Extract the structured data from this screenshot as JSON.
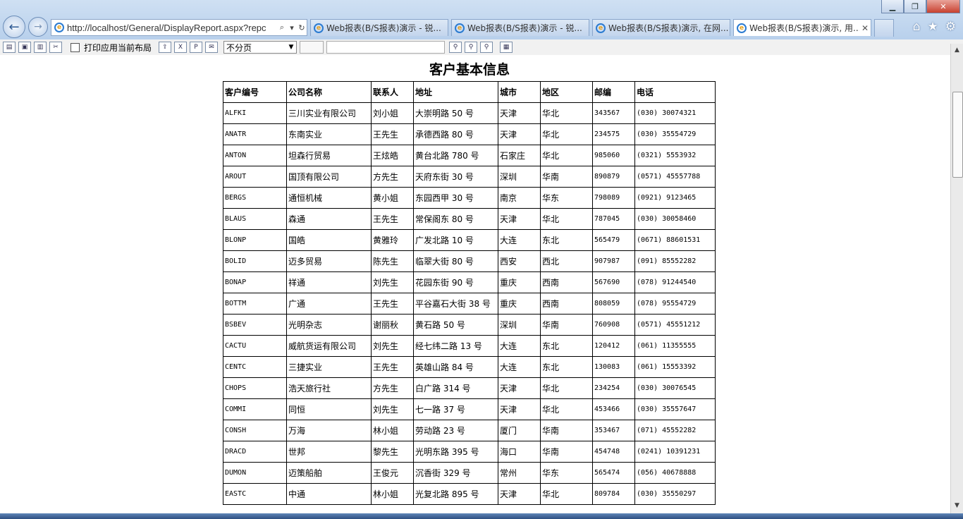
{
  "browser": {
    "address": "http://localhost/General/DisplayReport.aspx?repc",
    "tabs": [
      {
        "title": "Web报表(B/S报表)演示 - 锐...",
        "active": false
      },
      {
        "title": "Web报表(B/S报表)演示 - 锐...",
        "active": false
      },
      {
        "title": "Web报表(B/S报表)演示, 在网...",
        "active": false
      },
      {
        "title": "Web报表(B/S报表)演示, 用...",
        "active": true
      }
    ]
  },
  "toolbar": {
    "print_layout_label": "打印应用当前布局",
    "paging_option": "不分页"
  },
  "report": {
    "title": "客户基本信息",
    "columns": [
      "客户编号",
      "公司名称",
      "联系人",
      "地址",
      "城市",
      "地区",
      "邮编",
      "电话"
    ],
    "rows": [
      [
        "ALFKI",
        "三川实业有限公司",
        "刘小姐",
        "大崇明路 50 号",
        "天津",
        "华北",
        "343567",
        "(030) 30074321"
      ],
      [
        "ANATR",
        "东南实业",
        "王先生",
        "承德西路 80 号",
        "天津",
        "华北",
        "234575",
        "(030) 35554729"
      ],
      [
        "ANTON",
        "坦森行贸易",
        "王炫皓",
        "黄台北路 780 号",
        "石家庄",
        "华北",
        "985060",
        "(0321) 5553932"
      ],
      [
        "AROUT",
        "国顶有限公司",
        "方先生",
        "天府东街 30 号",
        "深圳",
        "华南",
        "890879",
        "(0571) 45557788"
      ],
      [
        "BERGS",
        "通恒机械",
        "黄小姐",
        "东园西甲 30 号",
        "南京",
        "华东",
        "798089",
        "(0921) 9123465"
      ],
      [
        "BLAUS",
        "森通",
        "王先生",
        "常保阁东 80 号",
        "天津",
        "华北",
        "787045",
        "(030) 30058460"
      ],
      [
        "BLONP",
        "国皓",
        "黄雅玲",
        "广发北路 10 号",
        "大连",
        "东北",
        "565479",
        "(0671) 88601531"
      ],
      [
        "BOLID",
        "迈多贸易",
        "陈先生",
        "临翠大街 80 号",
        "西安",
        "西北",
        "907987",
        "(091) 85552282"
      ],
      [
        "BONAP",
        "祥通",
        "刘先生",
        "花园东街 90 号",
        "重庆",
        "西南",
        "567690",
        "(078) 91244540"
      ],
      [
        "BOTTM",
        "广通",
        "王先生",
        "平谷嘉石大街 38 号",
        "重庆",
        "西南",
        "808059",
        "(078) 95554729"
      ],
      [
        "BSBEV",
        "光明杂志",
        "谢丽秋",
        "黄石路 50 号",
        "深圳",
        "华南",
        "760908",
        "(0571) 45551212"
      ],
      [
        "CACTU",
        "威航货运有限公司",
        "刘先生",
        "经七纬二路 13 号",
        "大连",
        "东北",
        "120412",
        "(061) 11355555"
      ],
      [
        "CENTC",
        "三捷实业",
        "王先生",
        "英雄山路 84 号",
        "大连",
        "东北",
        "130083",
        "(061) 15553392"
      ],
      [
        "CHOPS",
        "浩天旅行社",
        "方先生",
        "白广路 314 号",
        "天津",
        "华北",
        "234254",
        "(030) 30076545"
      ],
      [
        "COMMI",
        "同恒",
        "刘先生",
        "七一路 37 号",
        "天津",
        "华北",
        "453466",
        "(030) 35557647"
      ],
      [
        "CONSH",
        "万海",
        "林小姐",
        "劳动路 23 号",
        "厦门",
        "华南",
        "353467",
        "(071) 45552282"
      ],
      [
        "DRACD",
        "世邦",
        "黎先生",
        "光明东路 395 号",
        "海口",
        "华南",
        "454748",
        "(0241) 10391231"
      ],
      [
        "DUMON",
        "迈策船舶",
        "王俊元",
        "沉香街 329 号",
        "常州",
        "华东",
        "565474",
        "(056) 40678888"
      ],
      [
        "EASTC",
        "中通",
        "林小姐",
        "光复北路 895 号",
        "天津",
        "华北",
        "809784",
        "(030) 35550297"
      ]
    ]
  }
}
